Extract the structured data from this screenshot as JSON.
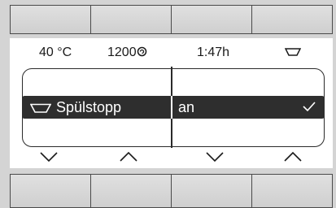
{
  "status": {
    "temperature": "40 °C",
    "spin_speed": "1200",
    "spin_icon": "spin-icon",
    "time": "1:47h",
    "detergent_icon": "basin-icon"
  },
  "menu": {
    "selected_item": {
      "label": "Spülstopp",
      "icon": "basin-icon",
      "value": "an",
      "checked": true
    }
  },
  "navigation": {
    "arrows": [
      "down",
      "up",
      "down",
      "up"
    ]
  },
  "colors": {
    "highlight": "#2e2e2e",
    "bezel": "#d4d4d4",
    "text": "#1a1a1a"
  }
}
